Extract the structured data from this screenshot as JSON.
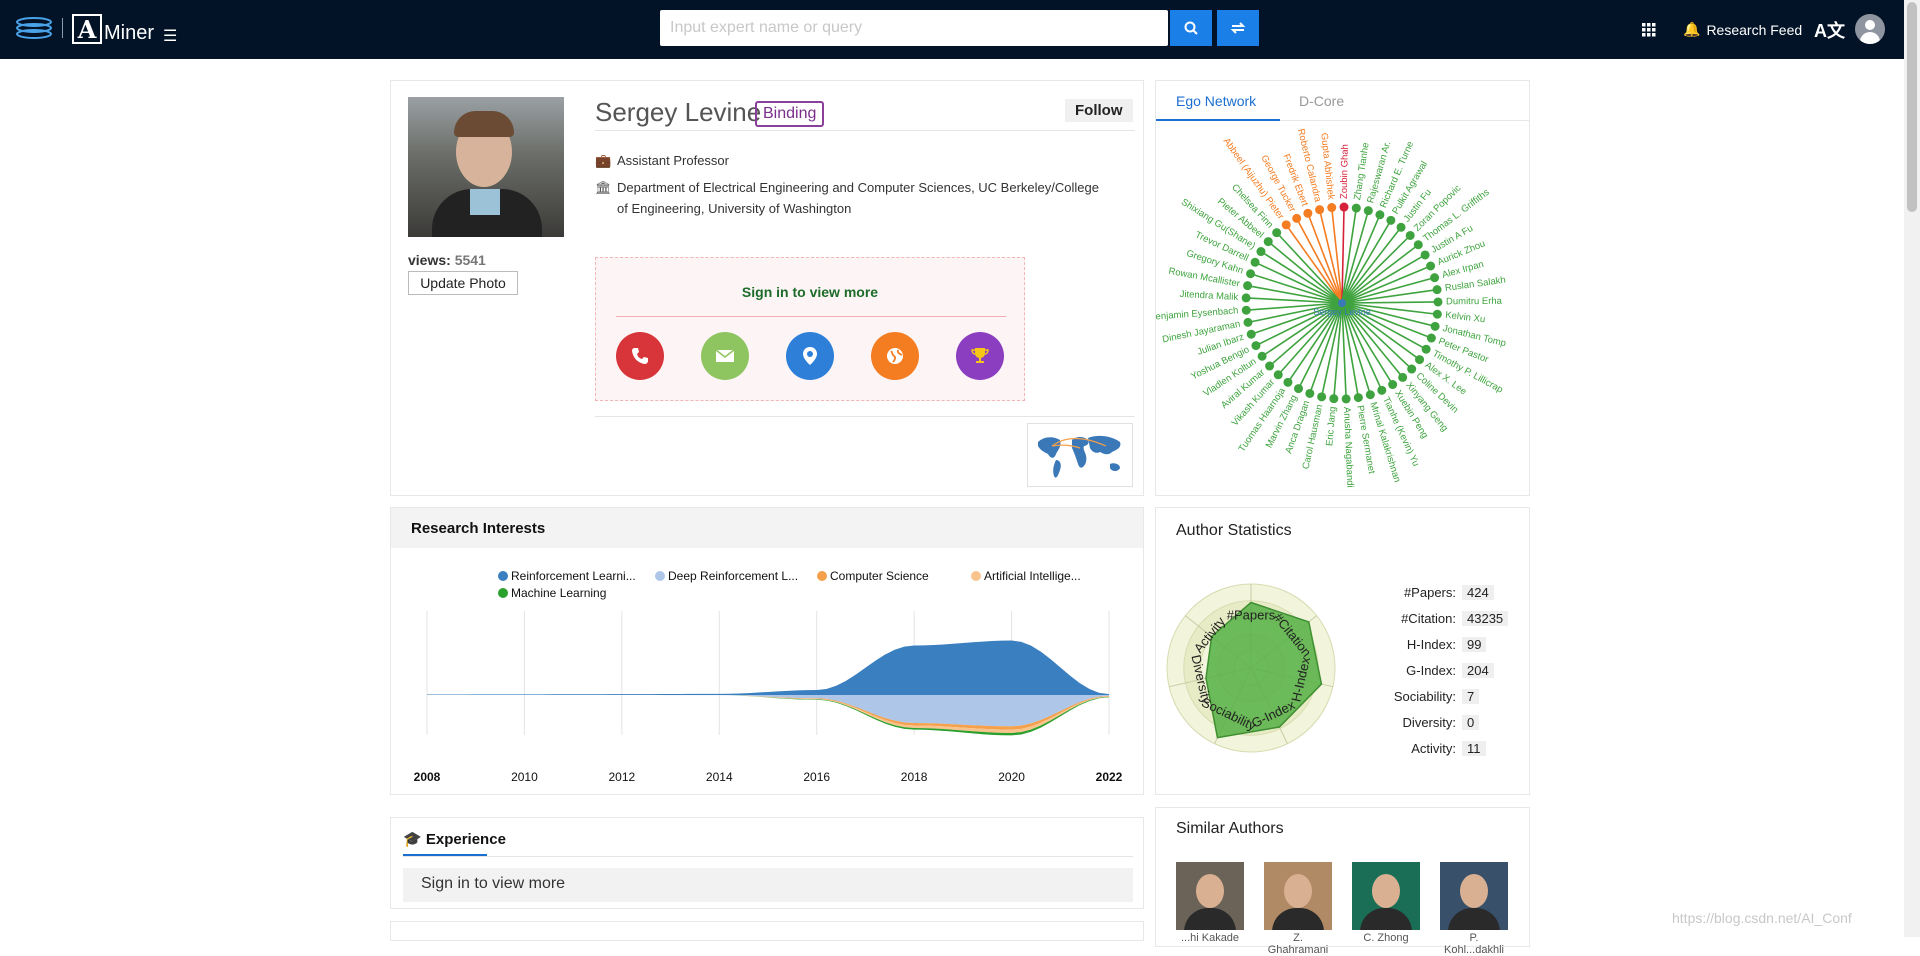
{
  "topbar": {
    "logo1_text": "",
    "logo2_text": "Miner",
    "search_placeholder": "Input expert name or query",
    "research_feed_label": "Research Feed",
    "lang_label": "A文"
  },
  "profile": {
    "name": "Sergey Levine",
    "binding_label": "Binding",
    "follow_label": "Follow",
    "title": "Assistant Professor",
    "affiliation_line1": "Department of Electrical Engineering and Computer Sciences, UC Berkeley/College",
    "affiliation_line2": "of Engineering, University of Washington",
    "views_label": "views:",
    "views_value": "5541",
    "update_photo_label": "Update Photo",
    "sign_in_label": "Sign in to view more",
    "contact_buttons": [
      {
        "icon": "phone-icon",
        "color": "#d7353a"
      },
      {
        "icon": "email-icon",
        "color": "#8fc561"
      },
      {
        "icon": "location-icon",
        "color": "#2e7fd8"
      },
      {
        "icon": "globe-icon",
        "color": "#f47c21"
      },
      {
        "icon": "trophy-icon",
        "color": "#8b3fc0"
      }
    ]
  },
  "ego_network": {
    "tab_active": "Ego Network",
    "tab_other": "D-Core",
    "center_label": "Sergey Levine",
    "nodes": [
      {
        "name": "Abbeel (Aijuzhu) Pieter",
        "color": "#f47c21"
      },
      {
        "name": "George Tucker",
        "color": "#f47c21"
      },
      {
        "name": "Fredrik Ebert",
        "color": "#f47c21"
      },
      {
        "name": "Roberto Calandra",
        "color": "#f47c21"
      },
      {
        "name": "Gupta Abhishek",
        "color": "#f47c21"
      },
      {
        "name": "Zoubin Ghah",
        "color": "#d6213a"
      },
      {
        "name": "Zhang Tianhe",
        "color": "#3ea33e"
      },
      {
        "name": "Rajeswaran Ar.",
        "color": "#3ea33e"
      },
      {
        "name": "Richard E. Turne",
        "color": "#3ea33e"
      },
      {
        "name": "Pulkit Agrawal",
        "color": "#3ea33e"
      },
      {
        "name": "Justin Fu",
        "color": "#3ea33e"
      },
      {
        "name": "Zoran Popovic",
        "color": "#3ea33e"
      },
      {
        "name": "Thomas L. Griffiths",
        "color": "#3ea33e"
      },
      {
        "name": "Justin A Fu",
        "color": "#3ea33e"
      },
      {
        "name": "Aurick Zhou",
        "color": "#3ea33e"
      },
      {
        "name": "Alex Irpan",
        "color": "#3ea33e"
      },
      {
        "name": "Ruslan Salakh",
        "color": "#3ea33e"
      },
      {
        "name": "Dumitru Erha",
        "color": "#3ea33e"
      },
      {
        "name": "Kelvin Xu",
        "color": "#3ea33e"
      },
      {
        "name": "Jonathan Tomp",
        "color": "#3ea33e"
      },
      {
        "name": "Peter Pastor",
        "color": "#3ea33e"
      },
      {
        "name": "Timothy P. Lillicrap",
        "color": "#3ea33e"
      },
      {
        "name": "Alex X. Lee",
        "color": "#3ea33e"
      },
      {
        "name": "Coline Devin",
        "color": "#3ea33e"
      },
      {
        "name": "Xinyang Geng",
        "color": "#3ea33e"
      },
      {
        "name": "Xuebin Peng",
        "color": "#3ea33e"
      },
      {
        "name": "Tianhe (Kevin) Yu",
        "color": "#3ea33e"
      },
      {
        "name": "Mrinal Kalakrishnan",
        "color": "#3ea33e"
      },
      {
        "name": "Pierre Sermanet",
        "color": "#3ea33e"
      },
      {
        "name": "Anusha Nagabandi",
        "color": "#3ea33e"
      },
      {
        "name": "Eric Jang",
        "color": "#3ea33e"
      },
      {
        "name": "Carol Hausman",
        "color": "#3ea33e"
      },
      {
        "name": "Anca Dragan",
        "color": "#3ea33e"
      },
      {
        "name": "Marvin Zhang",
        "color": "#3ea33e"
      },
      {
        "name": "Tuomas Haarnoja",
        "color": "#3ea33e"
      },
      {
        "name": "Vikash Kumar",
        "color": "#3ea33e"
      },
      {
        "name": "Aviral Kumar",
        "color": "#3ea33e"
      },
      {
        "name": "Vladlen Koltun",
        "color": "#3ea33e"
      },
      {
        "name": "Yoshua Bengio",
        "color": "#3ea33e"
      },
      {
        "name": "Julian Ibarz",
        "color": "#3ea33e"
      },
      {
        "name": "Dinesh Jayaraman",
        "color": "#3ea33e"
      },
      {
        "name": "Benjamin Eysenbach",
        "color": "#3ea33e"
      },
      {
        "name": "Jitendra Malik",
        "color": "#3ea33e"
      },
      {
        "name": "Rowan Mcallister",
        "color": "#3ea33e"
      },
      {
        "name": "Gregory Kahn",
        "color": "#3ea33e"
      },
      {
        "name": "Trevor Darrell",
        "color": "#3ea33e"
      },
      {
        "name": "Shixiang Gu(Shane)",
        "color": "#3ea33e"
      },
      {
        "name": "Pieter Abbeel",
        "color": "#3ea33e"
      },
      {
        "name": "Chelsea Finn",
        "color": "#3ea33e"
      }
    ]
  },
  "research_interests": {
    "heading": "Research Interests",
    "chart_data": {
      "type": "area",
      "x": [
        2008,
        2010,
        2012,
        2014,
        2016,
        2018,
        2020,
        2022
      ],
      "xlim": [
        2008,
        2022
      ],
      "series": [
        {
          "name": "Reinforcement Learni...",
          "color": "#3a7fc0",
          "values": [
            0.3,
            0.4,
            0.5,
            0.7,
            3,
            30,
            33,
            0.5
          ]
        },
        {
          "name": "Deep Reinforcement L...",
          "color": "#aec7e8",
          "values": [
            0,
            0,
            0,
            0.1,
            2,
            17,
            19,
            0.5
          ]
        },
        {
          "name": "Computer Science",
          "color": "#f5a04a",
          "values": [
            0,
            0,
            0,
            0,
            0.3,
            1.5,
            2,
            0.3
          ]
        },
        {
          "name": "Artificial Intellige...",
          "color": "#f7c48e",
          "values": [
            0,
            0,
            0,
            0,
            0.3,
            1.5,
            2,
            0.3
          ]
        },
        {
          "name": "Machine Learning",
          "color": "#2ca02c",
          "values": [
            0,
            0,
            0,
            0,
            0.3,
            1,
            1.5,
            0.3
          ]
        }
      ],
      "grid": true,
      "legend": "top"
    }
  },
  "author_statistics": {
    "heading": "Author Statistics",
    "radar_axes": [
      "#Papers",
      "#Citation",
      "H-Index",
      "G-Index",
      "Sociability",
      "Diversity",
      "Activity"
    ],
    "radar_values": [
      0.78,
      0.88,
      0.86,
      0.78,
      0.92,
      0.55,
      0.6
    ],
    "rows": [
      {
        "label": "#Papers:",
        "value": "424"
      },
      {
        "label": "#Citation:",
        "value": "43235"
      },
      {
        "label": "H-Index:",
        "value": "99"
      },
      {
        "label": "G-Index:",
        "value": "204"
      },
      {
        "label": "Sociability:",
        "value": "7"
      },
      {
        "label": "Diversity:",
        "value": "0"
      },
      {
        "label": "Activity:",
        "value": "11"
      }
    ]
  },
  "experience": {
    "heading": "Experience",
    "sign_in_label": "Sign in to view more"
  },
  "similar_authors": {
    "heading": "Similar Authors",
    "authors": [
      {
        "name": "...hi Kakade",
        "bg": "#6b6258"
      },
      {
        "name": "Z. Ghahramani",
        "bg": "#b08a64"
      },
      {
        "name": "C. Zhong",
        "bg": "#1a6e55"
      },
      {
        "name": "P. Kohl...dakhli",
        "bg": "#38506a"
      }
    ]
  },
  "watermark": "https://blog.csdn.net/AI_Conf"
}
